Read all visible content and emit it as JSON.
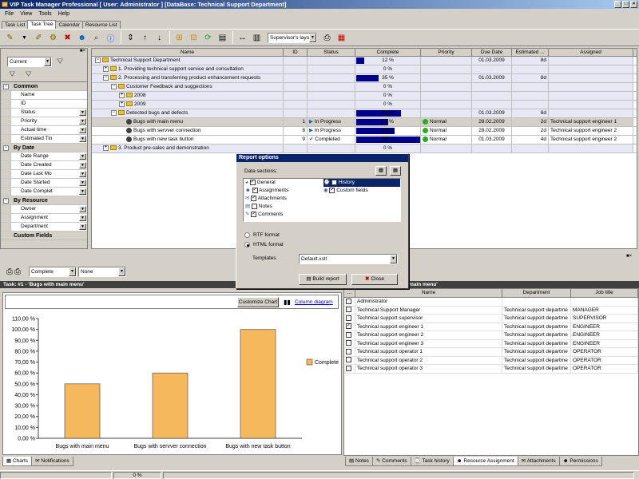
{
  "window": {
    "title": "VIP Task Manager Professional [ User: Administrator ] [DataBase: Technical Support Department]"
  },
  "menu": [
    "File",
    "View",
    "Tools",
    "Help"
  ],
  "tabs": [
    {
      "label": "Task List"
    },
    {
      "label": "Task Tree"
    },
    {
      "label": "Calendar"
    },
    {
      "label": "Resource List"
    }
  ],
  "toolbar": {
    "layout_combo": "Supervisor's layou"
  },
  "filter": {
    "scope": "Current",
    "groups": [
      {
        "title": "Common",
        "items": [
          "Name",
          "ID",
          "Status",
          "Priority",
          "Actual time",
          "Estimated Tin"
        ],
        "dropdown": [
          false,
          false,
          true,
          true,
          true,
          true
        ]
      },
      {
        "title": "By Date",
        "items": [
          "Date Range",
          "Date Created",
          "Date Last Mo",
          "Date Started",
          "Date Complet"
        ],
        "dropdown": [
          true,
          true,
          true,
          true,
          true
        ]
      },
      {
        "title": "By Resource",
        "items": [
          "Owner",
          "Assignment",
          "Department"
        ],
        "dropdown": [
          true,
          true,
          true
        ]
      }
    ],
    "custom_fields": "Custom Fields"
  },
  "grid": {
    "columns": [
      "Name",
      "ID",
      "Status",
      "Complete",
      "Priority",
      "Due Date",
      "Estimated ...",
      "Assigned"
    ],
    "rows": [
      {
        "name": "Technical Support Department",
        "id": "",
        "status": "",
        "complete": 12,
        "complete_label": "12 %",
        "priority": "",
        "due": "01.03.2009",
        "est": "8d",
        "assigned": ""
      },
      {
        "name": "1. Providing technical support service and consultation",
        "id": "",
        "status": "",
        "complete": 0,
        "complete_label": "0 %",
        "priority": "",
        "due": "",
        "est": "",
        "assigned": ""
      },
      {
        "name": "2. Processing and transferring product enhancement requests",
        "id": "",
        "status": "",
        "complete": 35,
        "complete_label": "35 %",
        "priority": "",
        "due": "01.03.2009",
        "est": "8d",
        "assigned": ""
      },
      {
        "name": "Customer Feedback and suggections",
        "id": "",
        "status": "",
        "complete": 0,
        "complete_label": "0 %",
        "priority": "",
        "due": "",
        "est": "",
        "assigned": ""
      },
      {
        "name": "2008",
        "id": "",
        "status": "",
        "complete": 0,
        "complete_label": "0 %",
        "priority": "",
        "due": "",
        "est": "",
        "assigned": ""
      },
      {
        "name": "2009",
        "id": "",
        "status": "",
        "complete": 0,
        "complete_label": "0 %",
        "priority": "",
        "due": "",
        "est": "",
        "assigned": ""
      },
      {
        "name": "Detected bugs and defects",
        "id": "",
        "status": "",
        "complete": 70,
        "complete_label": "70 %",
        "priority": "",
        "due": "01.03.2009",
        "est": "8d",
        "assigned": ""
      },
      {
        "name": "Bugs with main menu",
        "id": "1",
        "status": "In Progress",
        "complete": 50,
        "complete_label": "50 %",
        "priority": "Normal",
        "due": "28.02.2009",
        "est": "2d",
        "assigned": "Technical support engineer 1"
      },
      {
        "name": "Bugs with servver connection",
        "id": "8",
        "status": "In Progress",
        "complete": 60,
        "complete_label": "60 %",
        "priority": "Normal",
        "due": "28.02.2009",
        "est": "2d",
        "assigned": "Technical support engineer 2"
      },
      {
        "name": "Bugs with new task button",
        "id": "9",
        "status": "Completed",
        "complete": 100,
        "complete_label": "100 %",
        "priority": "Normal",
        "due": "01.03.2009",
        "est": "4d",
        "assigned": "Technical support engineer 2"
      },
      {
        "name": "3. Product pre-sales and demonstration",
        "id": "",
        "status": "",
        "complete": 0,
        "complete_label": "0 %",
        "priority": "",
        "due": "",
        "est": "",
        "assigned": ""
      }
    ]
  },
  "lower_toolbar": {
    "report_combo": "Complete",
    "second_combo": "None"
  },
  "task_header": "Task: #1 - 'Bugs with main menu'",
  "task_header_right": "main menu'",
  "chart_controls": {
    "customize": "Customize Chart",
    "column_diagram": "Column diagram"
  },
  "chart_data": {
    "type": "bar",
    "categories": [
      "Bugs with main menu",
      "Bugs with servver connection",
      "Bugs with new task button"
    ],
    "series": [
      {
        "name": "Complete",
        "values": [
          50,
          60,
          100
        ]
      }
    ],
    "ylim": [
      0,
      110
    ],
    "yticks": [
      "0,00 %",
      "10,00 %",
      "20,00 %",
      "30,00 %",
      "40,00 %",
      "50,00 %",
      "60,00 %",
      "70,00 %",
      "80,00 %",
      "90,00 %",
      "100,00 %",
      "110,00 %"
    ],
    "legend": "right",
    "color": "#f5b85c"
  },
  "bottom_left_tabs": [
    "Charts",
    "Notifications"
  ],
  "resource": {
    "columns": [
      "...",
      "Name",
      "Department",
      "Job title"
    ],
    "rows": [
      {
        "checked": false,
        "name": "Administrator",
        "dept": "",
        "job": ""
      },
      {
        "checked": false,
        "name": "Technical Support Manager",
        "dept": "Technical support departme",
        "job": "MANAGER"
      },
      {
        "checked": false,
        "name": "Technical support supervisor",
        "dept": "Technical support departme",
        "job": "SUPERVISOR"
      },
      {
        "checked": true,
        "name": "Technical support engineer 1",
        "dept": "Technical support departme",
        "job": "ENGINEER"
      },
      {
        "checked": false,
        "name": "Technical support engineer 2",
        "dept": "Technical support departme",
        "job": "ENGINEER"
      },
      {
        "checked": false,
        "name": "Technical support engineer 3",
        "dept": "Technical support departme",
        "job": "ENGINEER"
      },
      {
        "checked": false,
        "name": "Technical support operator 1",
        "dept": "Technical support departme",
        "job": "OPERATOR"
      },
      {
        "checked": false,
        "name": "Technical support operator 2",
        "dept": "Technical support departme",
        "job": "OPERATOR"
      },
      {
        "checked": false,
        "name": "Technical support operator 3",
        "dept": "Technical support departme",
        "job": "OPERATOR"
      }
    ]
  },
  "bottom_right_tabs": [
    "Notes",
    "Comments",
    "Task history",
    "Resource Assignment",
    "Attachments",
    "Permissions"
  ],
  "status": {
    "progress": "0 %"
  },
  "dialog": {
    "title": "Report options",
    "sections_label": "Data sections:",
    "items": [
      {
        "label": "General",
        "checked": true
      },
      {
        "label": "Assignments",
        "checked": true
      },
      {
        "label": "Attachments",
        "checked": true
      },
      {
        "label": "Notes",
        "checked": false
      },
      {
        "label": "Comments",
        "checked": true
      },
      {
        "label": "History",
        "checked": false
      },
      {
        "label": "Custom fields",
        "checked": true
      }
    ],
    "rtf": "RTF format",
    "html": "HTML format",
    "templates_label": "Templates",
    "template_value": "Default.xslt",
    "build": "Build report",
    "close": "Close"
  }
}
